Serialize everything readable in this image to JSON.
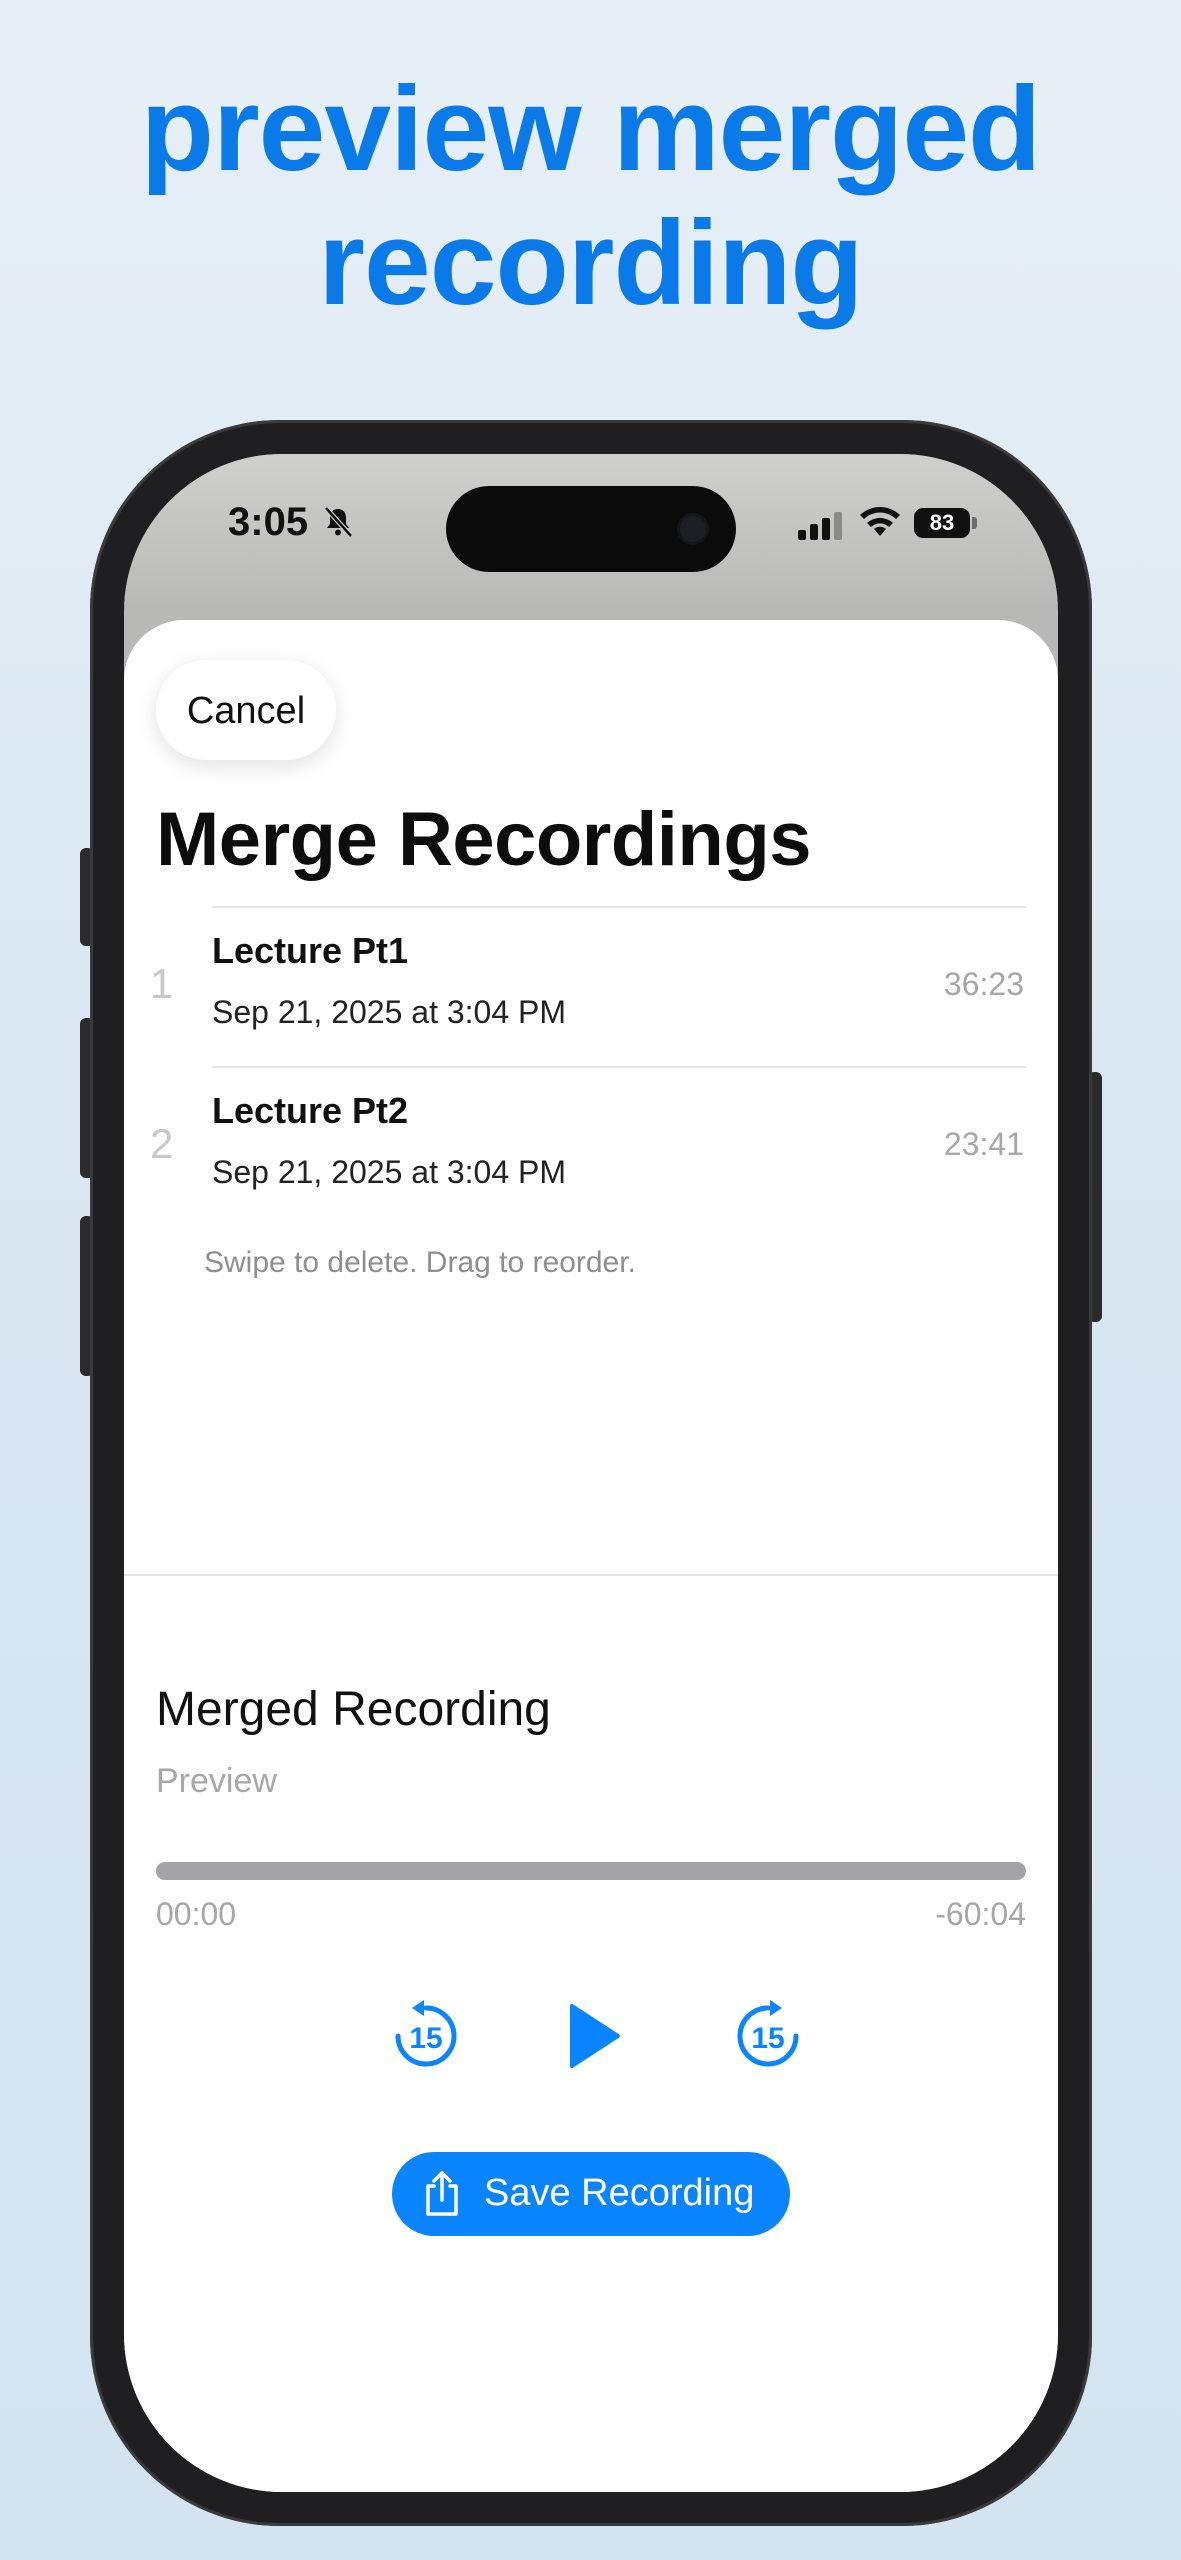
{
  "headline": {
    "line1": "preview merged",
    "line2": "recording"
  },
  "status_bar": {
    "time": "3:05",
    "battery": "83",
    "icons": [
      "bell-slash-icon",
      "cellular-signal-icon",
      "wifi-icon",
      "battery-icon"
    ]
  },
  "sheet": {
    "cancel_label": "Cancel",
    "title": "Merge Recordings",
    "recordings": [
      {
        "index": "1",
        "name": "Lecture Pt1",
        "date": "Sep 21, 2025 at 3:04 PM",
        "duration": "36:23"
      },
      {
        "index": "2",
        "name": "Lecture Pt2",
        "date": "Sep 21, 2025 at 3:04 PM",
        "duration": "23:41"
      }
    ],
    "hint": "Swipe to delete. Drag to reorder."
  },
  "preview": {
    "title": "Merged Recording",
    "subtitle": "Preview",
    "progress": 0,
    "elapsed": "00:00",
    "remaining": "-60:04",
    "skip_back_seconds": "15",
    "skip_forward_seconds": "15",
    "save_label": "Save Recording"
  },
  "colors": {
    "accent": "#0a84ff",
    "headline": "#0a7ae8"
  }
}
